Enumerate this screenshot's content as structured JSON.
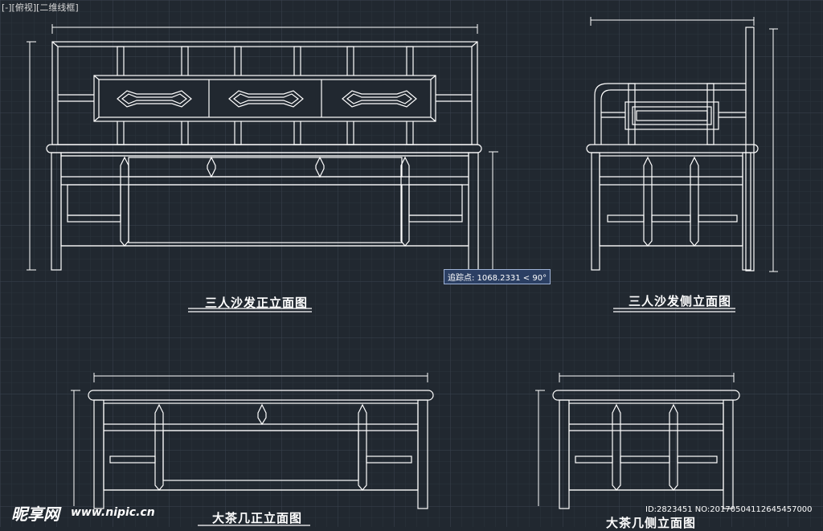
{
  "viewport": {
    "label": "[-][俯视][二维线框]"
  },
  "drawings": [
    {
      "title": "三人沙发正立面图"
    },
    {
      "title": "三人沙发侧立面图"
    },
    {
      "title": "大茶几正立面图"
    },
    {
      "title": "大茶几侧立面图"
    }
  ],
  "tracking_tooltip": {
    "text": "追踪点: 1068.2331 < 90°"
  },
  "watermark": {
    "logo": "昵享网",
    "url": "www.nipic.cn",
    "id_text": "ID:2823451 NO:20170504112645457000"
  },
  "colors": {
    "background": "#212830",
    "grid_minor": "#2c343d",
    "grid_major": "#3a4350",
    "lines": "#ffffff",
    "tooltip_bg": "#2b3f63"
  }
}
